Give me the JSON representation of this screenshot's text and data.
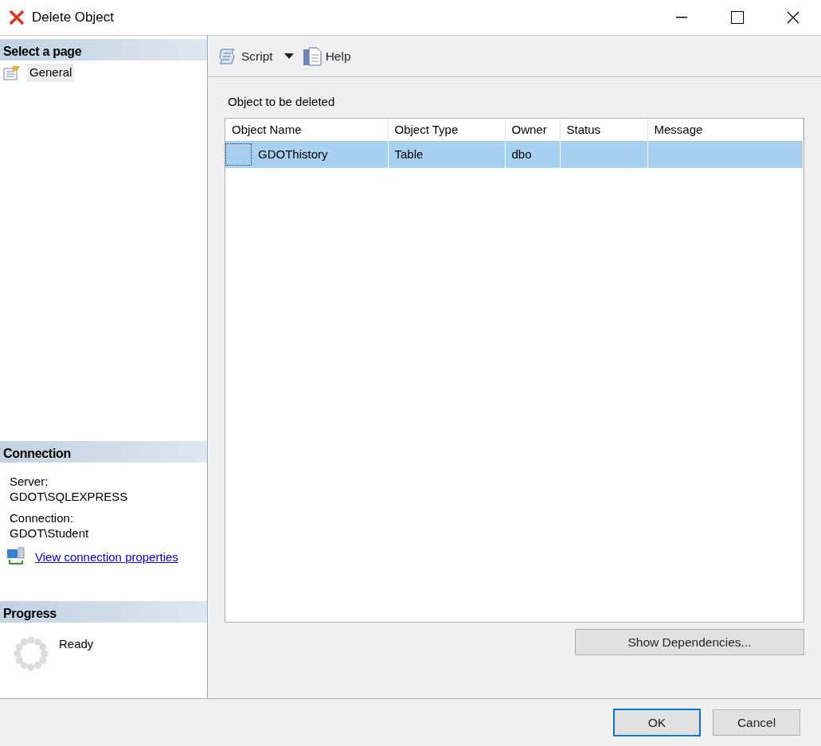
{
  "window": {
    "title": "Delete Object"
  },
  "page_selector": {
    "title": "Select a page",
    "items": [
      {
        "label": "General",
        "selected": true
      }
    ]
  },
  "connection": {
    "title": "Connection",
    "server_label": "Server:",
    "server": "GDOT\\SQLEXPRESS",
    "connection_label": "Connection:",
    "connection": "GDOT\\Student",
    "link": "View connection properties"
  },
  "progress": {
    "title": "Progress",
    "status": "Ready"
  },
  "toolbar": {
    "script": "Script",
    "help": "Help"
  },
  "objects": {
    "label": "Object to be deleted",
    "columns": [
      "Object Name",
      "Object Type",
      "Owner",
      "Status",
      "Message"
    ],
    "rows": [
      {
        "cells": [
          "GDOThistory",
          "Table",
          "dbo"
        ],
        "selected": true
      }
    ]
  },
  "show_dependencies": "Show Dependencies...",
  "buttons": [
    {
      "label": "OK",
      "default": true
    },
    {
      "label": "Cancel",
      "default": false
    }
  ]
}
